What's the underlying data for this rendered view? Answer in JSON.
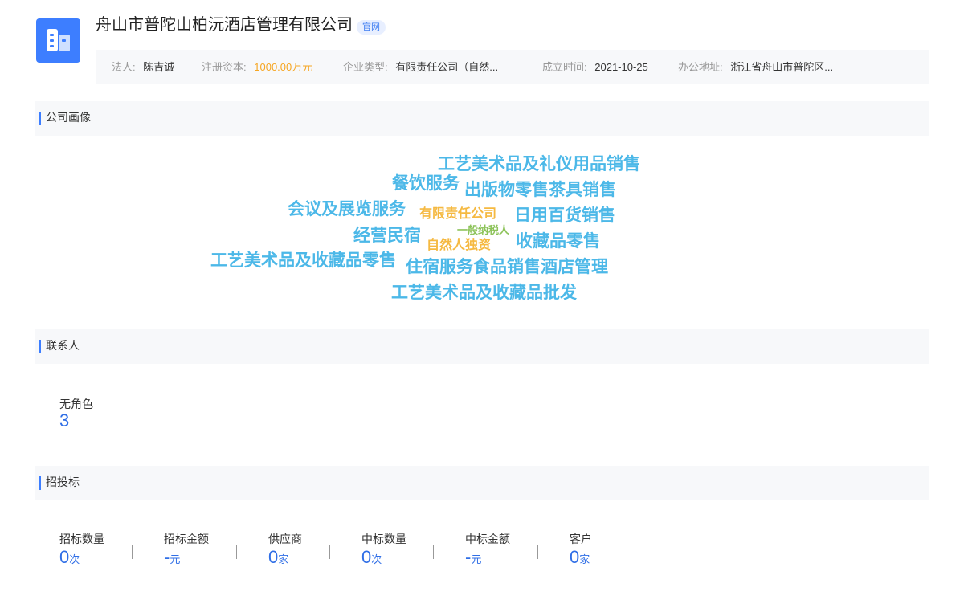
{
  "company": {
    "name": "舟山市普陀山柏沅酒店管理有限公司",
    "official_badge": "官网"
  },
  "info": {
    "legal_person_label": "法人:",
    "legal_person": "陈吉诚",
    "capital_label": "注册资本:",
    "capital": "1000.00万元",
    "type_label": "企业类型:",
    "type": "有限责任公司（自然...",
    "founded_label": "成立时间:",
    "founded": "2021-10-25",
    "address_label": "办公地址:",
    "address": "浙江省舟山市普陀区..."
  },
  "sections": {
    "profile": "公司画像",
    "contacts": "联系人",
    "bidding": "招投标"
  },
  "word_cloud": [
    {
      "text": "工艺美术品及礼仪用品销售",
      "color": "#4cb8e8"
    },
    {
      "text": "餐饮服务",
      "color": "#4cb8e8"
    },
    {
      "text": "出版物零售茶具销售",
      "color": "#4cb8e8"
    },
    {
      "text": "会议及展览服务",
      "color": "#4cb8e8"
    },
    {
      "text": "有限责任公司",
      "color": "#f5b941"
    },
    {
      "text": "日用百货销售",
      "color": "#4cb8e8"
    },
    {
      "text": "一般纳税人",
      "color": "#8dc35a"
    },
    {
      "text": "经营民宿",
      "color": "#4cb8e8"
    },
    {
      "text": "自然人独资",
      "color": "#f5b941"
    },
    {
      "text": "收藏品零售",
      "color": "#4cb8e8"
    },
    {
      "text": "工艺美术品及收藏品零售",
      "color": "#4cb8e8"
    },
    {
      "text": "住宿服务食品销售酒店管理",
      "color": "#4cb8e8"
    },
    {
      "text": "工艺美术品及收藏品批发",
      "color": "#4cb8e8"
    }
  ],
  "contacts": {
    "role_label": "无角色",
    "role_count": "3"
  },
  "bidding": {
    "stats": [
      {
        "label": "招标数量",
        "value": "0",
        "unit": "次"
      },
      {
        "label": "招标金额",
        "value": "-",
        "unit": "元"
      },
      {
        "label": "供应商",
        "value": "0",
        "unit": "家"
      },
      {
        "label": "中标数量",
        "value": "0",
        "unit": "次"
      },
      {
        "label": "中标金额",
        "value": "-",
        "unit": "元"
      },
      {
        "label": "客户",
        "value": "0",
        "unit": "家"
      }
    ]
  },
  "colors": {
    "accent": "#3d7eff",
    "money": "#f6a623",
    "cloud_blue": "#4cb8e8",
    "cloud_orange": "#f5b941",
    "cloud_green": "#8dc35a"
  }
}
